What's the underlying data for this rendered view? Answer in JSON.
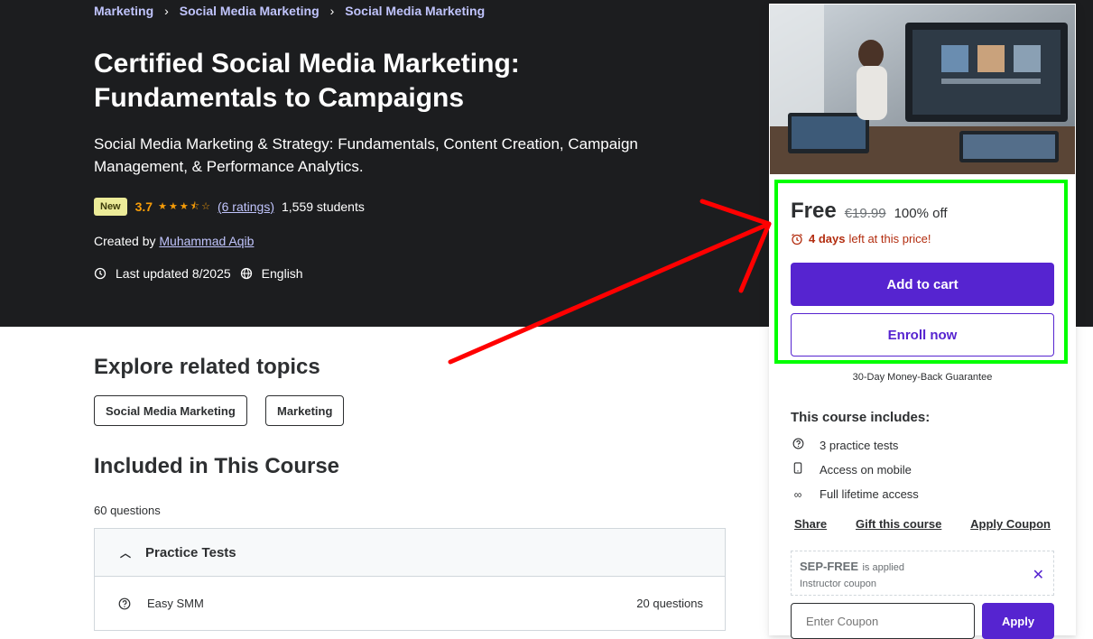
{
  "breadcrumb": [
    "Marketing",
    "Social Media Marketing",
    "Social Media Marketing"
  ],
  "course": {
    "title": "Certified Social Media Marketing: Fundamentals to Campaigns",
    "subtitle": "Social Media Marketing & Strategy: Fundamentals, Content Creation, Campaign Management, & Performance Analytics.",
    "badge": "New",
    "rating": "3.7",
    "rating_value": 3.7,
    "ratings_link": "(6 ratings)",
    "students": "1,559 students",
    "created_by_label": "Created by",
    "author": "Muhammad Aqib",
    "last_updated": "Last updated 8/2025",
    "language": "English"
  },
  "card": {
    "price": "Free",
    "original_price": "€19.99",
    "discount": "100% off",
    "timer_days": "4 days",
    "timer_text": "left at this price!",
    "add_to_cart": "Add to cart",
    "enroll_now": "Enroll now",
    "guarantee": "30-Day Money-Back Guarantee",
    "includes_title": "This course includes:",
    "includes": [
      {
        "icon": "question-circle-icon",
        "label": "3 practice tests"
      },
      {
        "icon": "mobile-icon",
        "label": "Access on mobile"
      },
      {
        "icon": "infinity-icon",
        "label": "Full lifetime access"
      }
    ],
    "links": [
      "Share",
      "Gift this course",
      "Apply Coupon"
    ],
    "coupon": {
      "code": "SEP-FREE",
      "applied": "is applied",
      "sub": "Instructor coupon",
      "input_placeholder": "Enter Coupon",
      "apply": "Apply"
    }
  },
  "related": {
    "title": "Explore related topics",
    "topics": [
      "Social Media Marketing",
      "Marketing"
    ]
  },
  "included": {
    "title": "Included in This Course",
    "question_count": "60 questions",
    "section_title": "Practice Tests",
    "rows": [
      {
        "label": "Easy SMM",
        "count": "20 questions"
      }
    ]
  },
  "colors": {
    "accent": "#5624d0",
    "hero_bg": "#1c1d1f",
    "annotation_arrow": "#ff0000",
    "annotation_box": "#00ff00"
  }
}
